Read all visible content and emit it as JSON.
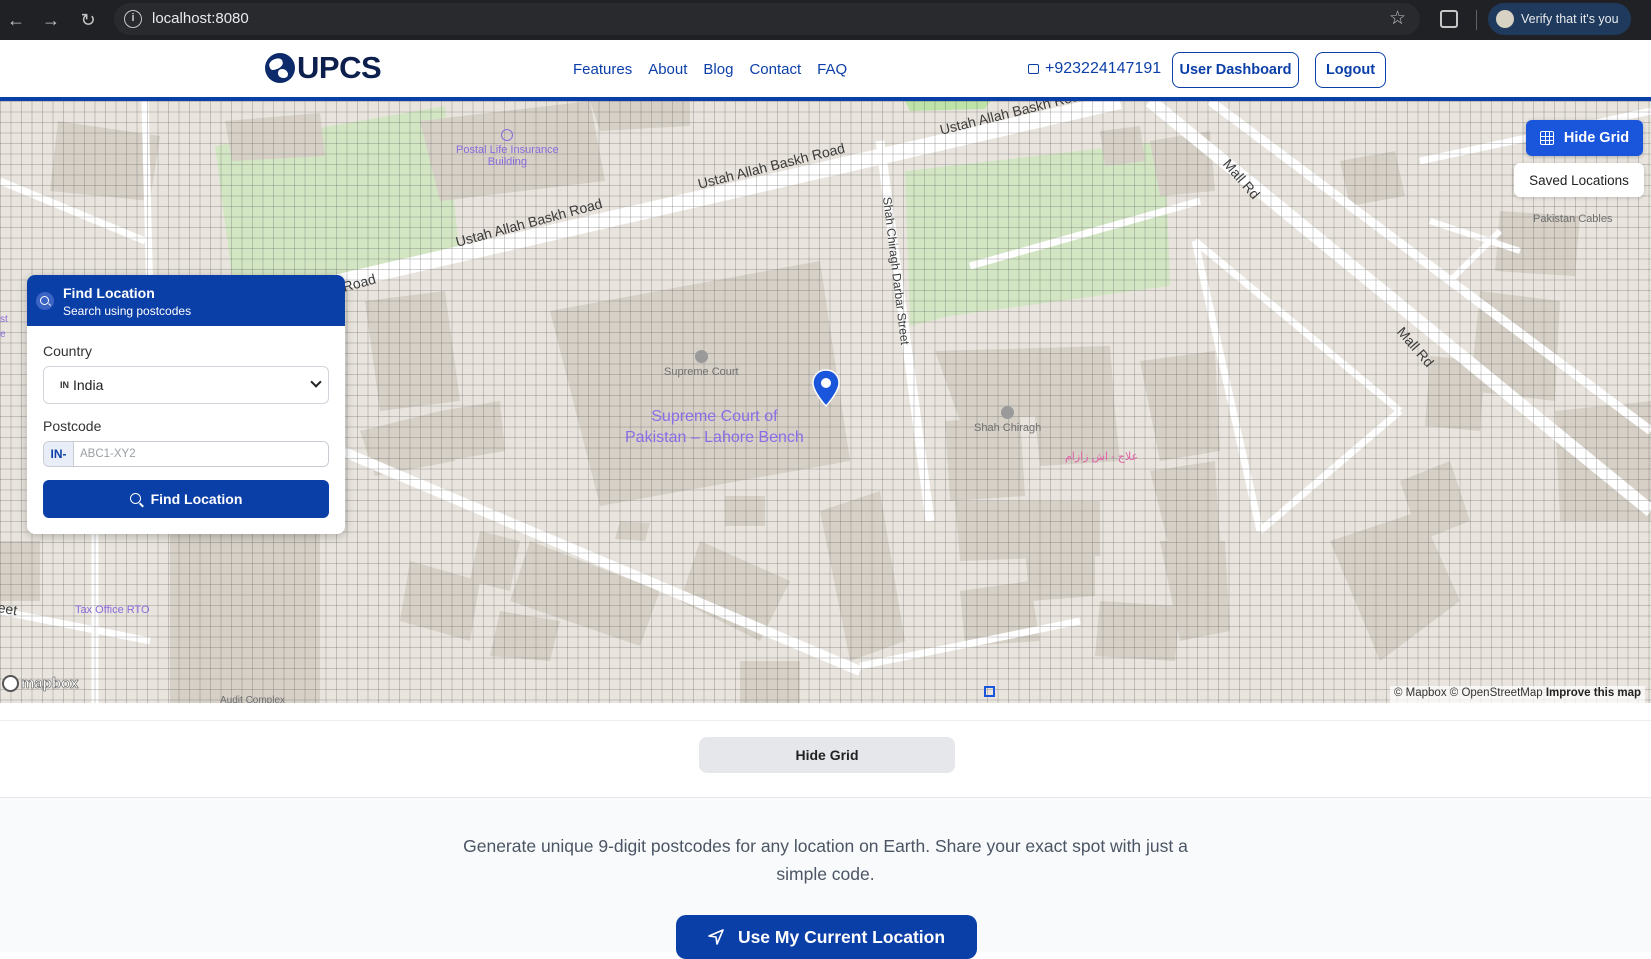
{
  "browser": {
    "url": "localhost:8080",
    "profile_label": "Verify that it's you",
    "icons": [
      "back-arrow-icon",
      "forward-arrow-icon",
      "reload-icon",
      "site-info-icon",
      "bookmark-star-icon",
      "extensions-icon",
      "profile-avatar-icon"
    ]
  },
  "header": {
    "logo_text": "UPCS",
    "nav": [
      "Features",
      "About",
      "Blog",
      "Contact",
      "FAQ"
    ],
    "phone": "+923224147191",
    "dashboard_label": "User Dashboard",
    "logout_label": "Logout"
  },
  "map": {
    "hide_grid_label": "Hide Grid",
    "saved_locations_label": "Saved Locations",
    "roads": {
      "r1": "Ustah Allah Baskh Road",
      "r2": "Ustah Allah Baskh Road",
      "r3": "Ustah Allah Baskh Road",
      "r4": "Road",
      "shah": "Shah Chiragh Darbar Street",
      "mall1": "Mall Rd",
      "mall2": "Mall Rd",
      "eet": "eet",
      "st": "st",
      "e": "e"
    },
    "pois": {
      "postal_line1": "Postal Life Insurance",
      "postal_line2": "Building",
      "supreme_small": "Supreme Court",
      "supreme_big_line1": "Supreme Court of",
      "supreme_big_line2": "Pakistan – Lahore Bench",
      "shah_chiragh": "Shah Chiragh",
      "urdu": "علاج - اش زازام",
      "tax_office": "Tax Office RTO",
      "audit_complex": "Audit Complex",
      "pakistan_cables": "Pakistan Cables"
    },
    "mapbox_logo": "mapbox",
    "attribution": "© Mapbox © OpenStreetMap",
    "improve": "Improve this map"
  },
  "find_panel": {
    "title": "Find Location",
    "subtitle": "Search using postcodes",
    "country_label": "Country",
    "country_flag": "IN",
    "country_value": "India",
    "postcode_label": "Postcode",
    "postcode_prefix": "IN-",
    "postcode_placeholder": "ABC1-XY2",
    "button_label": "Find Location"
  },
  "grid_toggle": {
    "label": "Hide Grid"
  },
  "hero": {
    "description": "Generate unique 9-digit postcodes for any location on Earth. Share your exact spot with just a simple code.",
    "use_location_label": "Use My Current Location"
  },
  "colors": {
    "primary": "#0b3fa8",
    "accent": "#1a56db",
    "poi_purple": "#8b6ce6",
    "map_bg": "#e9e5de",
    "park_green": "#d3e6c4"
  }
}
